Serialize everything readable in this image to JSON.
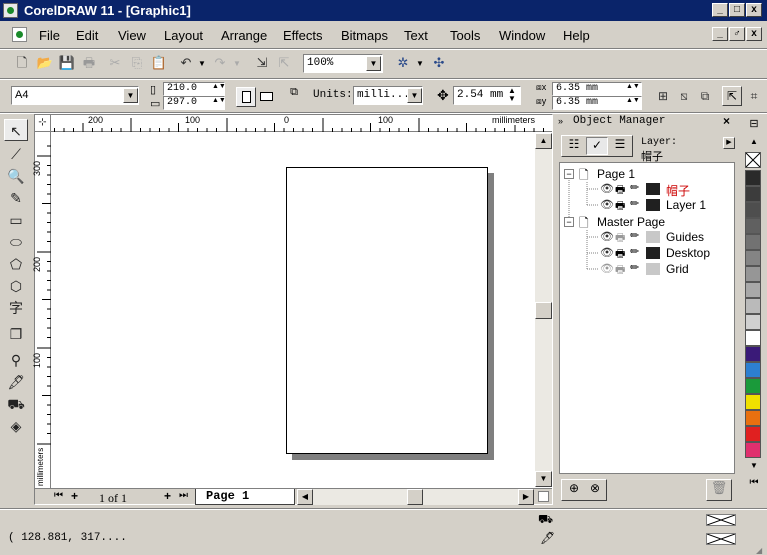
{
  "app": {
    "title": "CorelDRAW 11 - [Graphic1]",
    "window_buttons": [
      "_",
      "□",
      "x"
    ],
    "doc_buttons": [
      "_",
      "♂",
      "x"
    ]
  },
  "menu": [
    "File",
    "Edit",
    "View",
    "Layout",
    "Arrange",
    "Effects",
    "Bitmaps",
    "Text",
    "Tools",
    "Window",
    "Help"
  ],
  "toolbar": {
    "zoom_value": "100%"
  },
  "property_bar": {
    "paper_size": "A4",
    "width": "210.0",
    "height": "297.0",
    "units_label": "Units:",
    "units_value": "milli...",
    "nudge": "2.54 mm",
    "dup_x": "6.35 mm",
    "dup_y": "6.35 mm"
  },
  "rulers": {
    "h_labels": [
      "200",
      "100",
      "0",
      "100"
    ],
    "h_unit": "millimeters",
    "v_labels": [
      "300",
      "200",
      "100"
    ],
    "v_unit": "millimeters"
  },
  "page_nav": {
    "counter": "1 of 1",
    "tab": "Page 1"
  },
  "object_manager": {
    "title": "Object Manager",
    "layer_label": "Layer:",
    "layer_value": "帽子",
    "tree": [
      {
        "label": "Page 1",
        "type": "page"
      },
      {
        "label": "帽子",
        "type": "layer",
        "color": "#cc0000",
        "swatch": "#202020"
      },
      {
        "label": "Layer 1",
        "type": "layer",
        "color": "#000000",
        "swatch": "#202020"
      },
      {
        "label": "Master Page",
        "type": "page"
      },
      {
        "label": "Guides",
        "type": "layer",
        "color": "#000000",
        "swatch": "#c8c8c8"
      },
      {
        "label": "Desktop",
        "type": "layer",
        "color": "#000000",
        "swatch": "#202020"
      },
      {
        "label": "Grid",
        "type": "layer",
        "color": "#000000",
        "swatch": "#c8c8c8"
      }
    ]
  },
  "palette": [
    "#2a2a2a",
    "#3c3c3c",
    "#4e4e4e",
    "#606060",
    "#727272",
    "#848484",
    "#969696",
    "#a8a8a8",
    "#bababa",
    "#d0d0d0",
    "#ffffff",
    "#3a1a78",
    "#2d7fd0",
    "#1a9a3a",
    "#f0e000",
    "#e87010",
    "#e02020",
    "#e0306e"
  ],
  "status": {
    "coords": "( 128.881, 317...."
  }
}
